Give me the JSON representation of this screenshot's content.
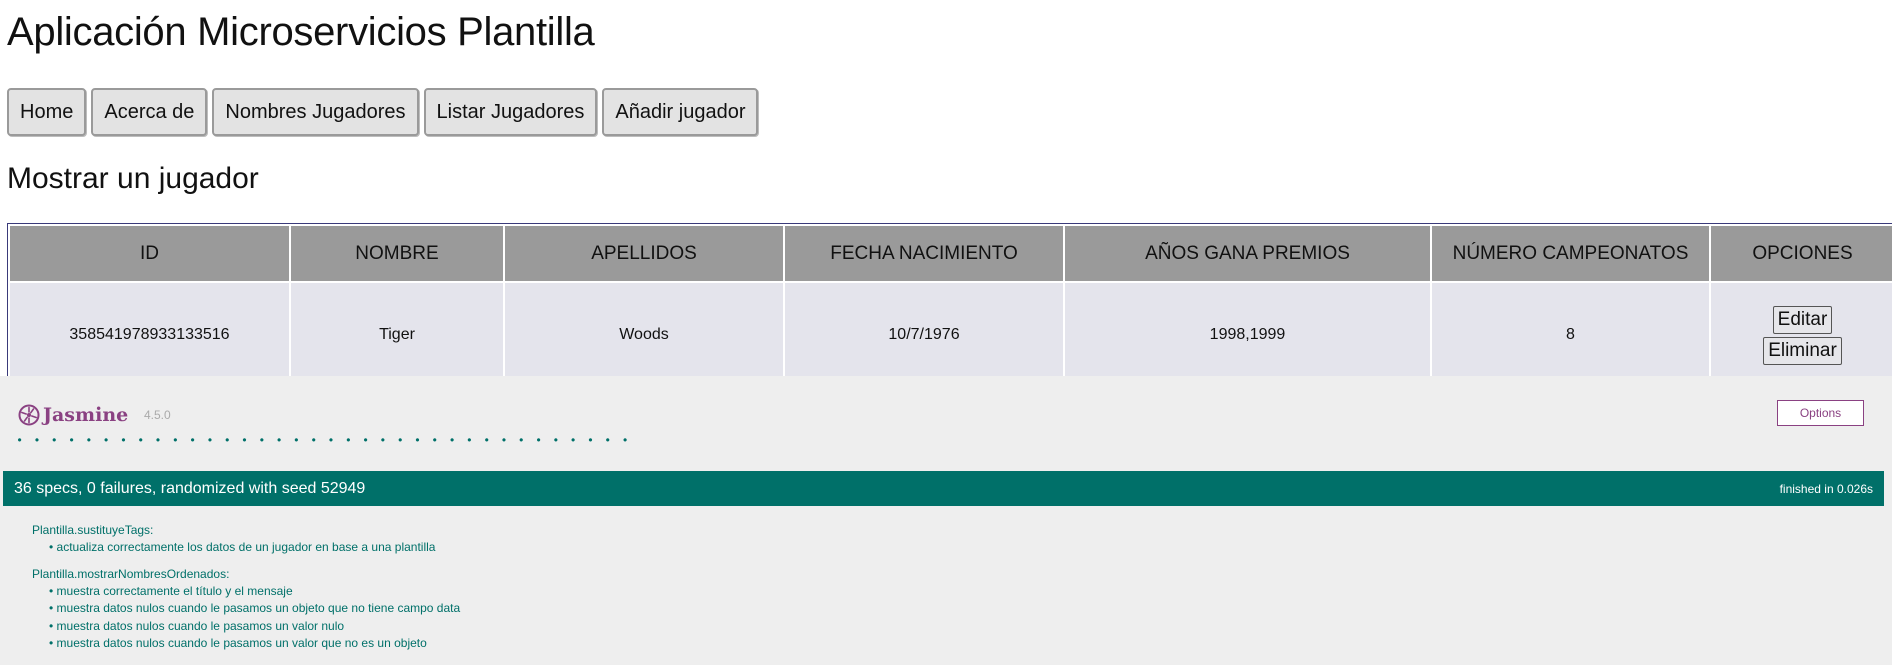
{
  "app_title": "Aplicación Microservicios Plantilla",
  "nav": {
    "home": "Home",
    "about": "Acerca de",
    "player_names": "Nombres Jugadores",
    "list_players": "Listar Jugadores",
    "add_player": "Añadir jugador"
  },
  "section_title": "Mostrar un jugador",
  "table": {
    "headers": [
      "ID",
      "NOMBRE",
      "APELLIDOS",
      "FECHA NACIMIENTO",
      "AÑOS GANA PREMIOS",
      "NÚMERO CAMPEONATOS",
      "OPCIONES"
    ],
    "row": {
      "id": "358541978933133516",
      "nombre": "Tiger",
      "apellidos": "Woods",
      "fecha_nacimiento": "10/7/1976",
      "anos_gana_premios": "1998,1999",
      "numero_campeonatos": "8"
    },
    "edit_label": "Editar",
    "delete_label": "Eliminar"
  },
  "jasmine": {
    "logo_text": "Jasmine",
    "version": "4.5.0",
    "options_label": "Options",
    "dot_count": 36,
    "summary": "36 specs, 0 failures, randomized with seed 52949",
    "finished": "finished in 0.026s",
    "suites": [
      {
        "name": "Plantilla.sustituyeTags:",
        "specs": [
          "actualiza correctamente los datos de un jugador en base a una plantilla"
        ]
      },
      {
        "name": "Plantilla.mostrarNombresOrdenados:",
        "specs": [
          "muestra correctamente el título y el mensaje",
          "muestra datos nulos cuando le pasamos un objeto que no tiene campo data",
          "muestra datos nulos cuando le pasamos un valor nulo",
          "muestra datos nulos cuando le pasamos un valor que no es un objeto"
        ]
      }
    ]
  },
  "colors": {
    "jasmine_purple": "#8a4182",
    "jasmine_green": "#007069",
    "header_gray": "#9a9a9a",
    "cell_bg": "#e4e4ec"
  }
}
